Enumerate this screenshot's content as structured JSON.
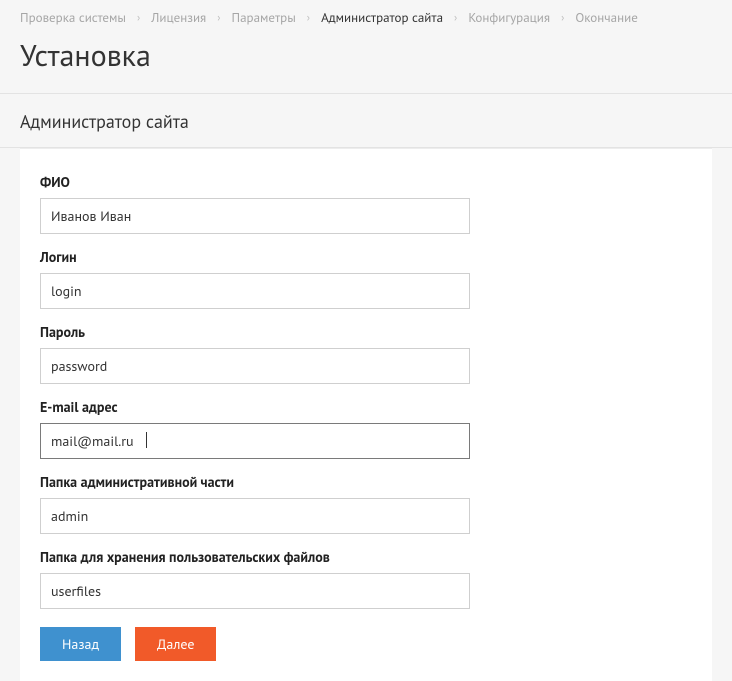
{
  "breadcrumb": {
    "items": [
      {
        "label": "Проверка системы",
        "active": false
      },
      {
        "label": "Лицензия",
        "active": false
      },
      {
        "label": "Параметры",
        "active": false
      },
      {
        "label": "Администратор сайта",
        "active": true
      },
      {
        "label": "Конфигурация",
        "active": false
      },
      {
        "label": "Окончание",
        "active": false
      }
    ]
  },
  "page_title": "Установка",
  "section_title": "Администратор сайта",
  "form": {
    "fullname": {
      "label": "ФИО",
      "value": "Иванов Иван"
    },
    "login": {
      "label": "Логин",
      "value": "login"
    },
    "password": {
      "label": "Пароль",
      "value": "password"
    },
    "email": {
      "label": "E-mail адрес",
      "value": "mail@mail.ru"
    },
    "admin_folder": {
      "label": "Папка административной части",
      "value": "admin"
    },
    "userfiles_folder": {
      "label": "Папка для хранения пользовательских файлов",
      "value": "userfiles"
    }
  },
  "buttons": {
    "back": "Назад",
    "next": "Далее"
  }
}
